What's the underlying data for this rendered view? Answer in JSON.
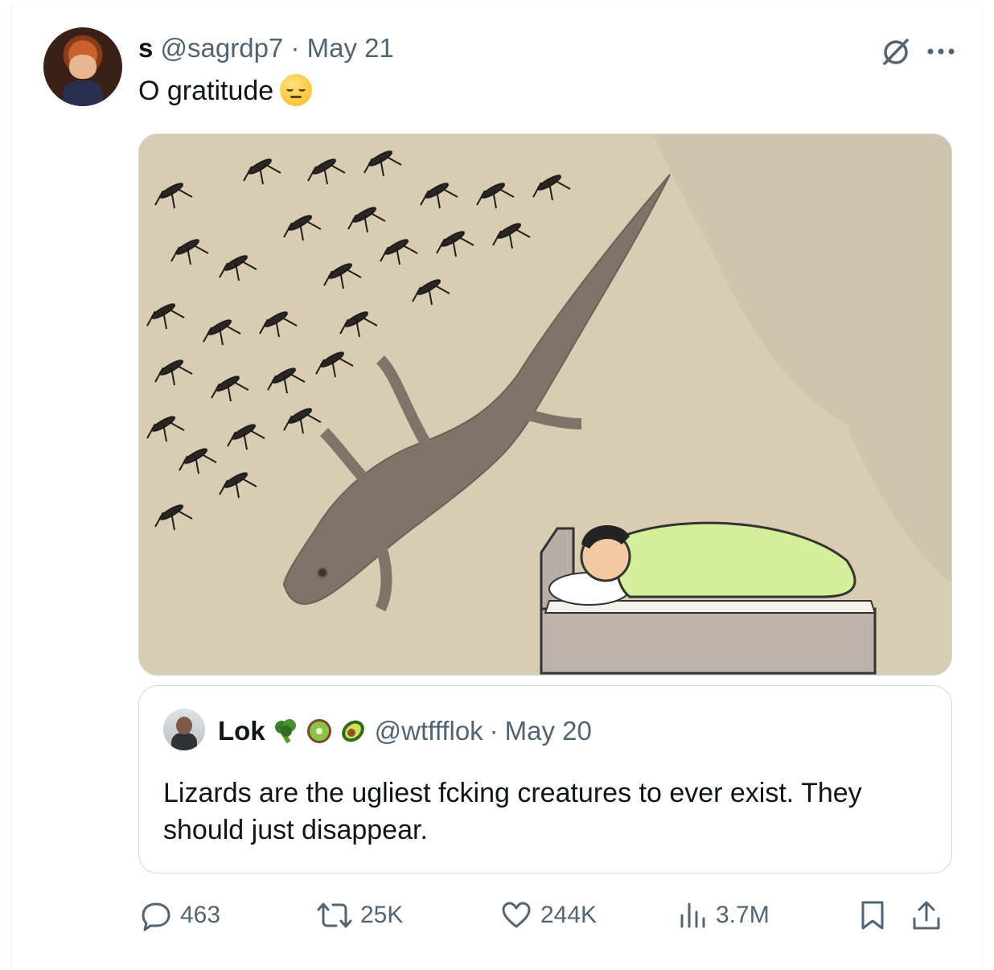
{
  "tweet": {
    "author_name": "s",
    "author_handle": "@sagrdp7",
    "separator": "·",
    "date": "May 21",
    "text": "O gratitude"
  },
  "quote": {
    "author_name": "Lok",
    "author_handle": "@wtffflok",
    "separator": "·",
    "date": "May 20",
    "text": "Lizards are the ugliest fcking creatures to ever exist. They should just disappear."
  },
  "stats": {
    "replies": "463",
    "reposts": "25K",
    "likes": "244K",
    "views": "3.7M"
  },
  "icons": [
    "avatar",
    "grok-icon",
    "more-icon",
    "sad-face-emoji",
    "broccoli-emoji",
    "kiwi-emoji",
    "avocado-emoji",
    "reply-icon",
    "repost-icon",
    "like-icon",
    "views-icon",
    "bookmark-icon",
    "share-icon"
  ],
  "colors": {
    "muted": "#536471",
    "text": "#0f1419",
    "border": "#cfd9de"
  }
}
